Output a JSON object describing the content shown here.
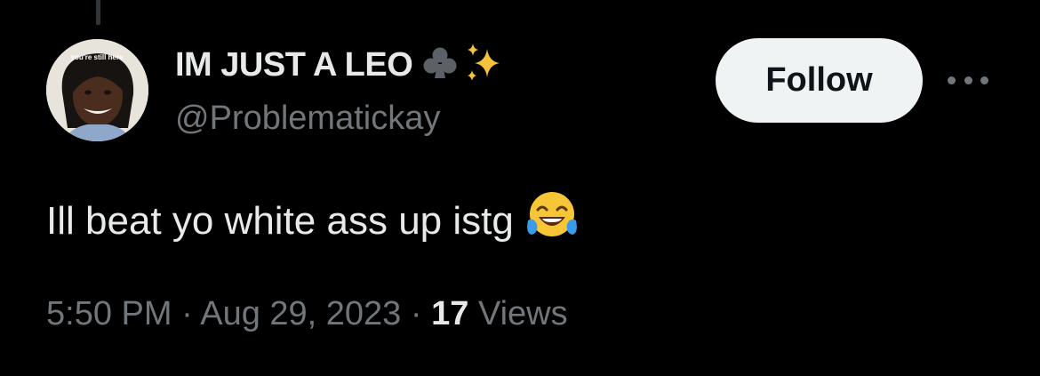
{
  "author": {
    "display_name": "IM JUST A LEO",
    "handle": "@Problematickay",
    "avatar_caption": "you're still here",
    "name_emojis": [
      "club-suit-icon",
      "sparkles-icon"
    ]
  },
  "actions": {
    "follow_label": "Follow",
    "more_icon": "more-horizontal-icon"
  },
  "tweet": {
    "text": "Ill beat yo white ass up istg",
    "emoji": "tears-of-joy-emoji-icon"
  },
  "meta": {
    "time": "5:50 PM",
    "separator": "·",
    "date": "Aug 29, 2023",
    "views_count": "17",
    "views_label": "Views"
  },
  "colors": {
    "background": "#000000",
    "primary_text": "#e7e9ea",
    "secondary_text": "#71767b",
    "follow_bg": "#eff3f4",
    "follow_text": "#0f1419",
    "emoji_yellow": "#f7c637",
    "emoji_tear": "#3a9ce8"
  }
}
